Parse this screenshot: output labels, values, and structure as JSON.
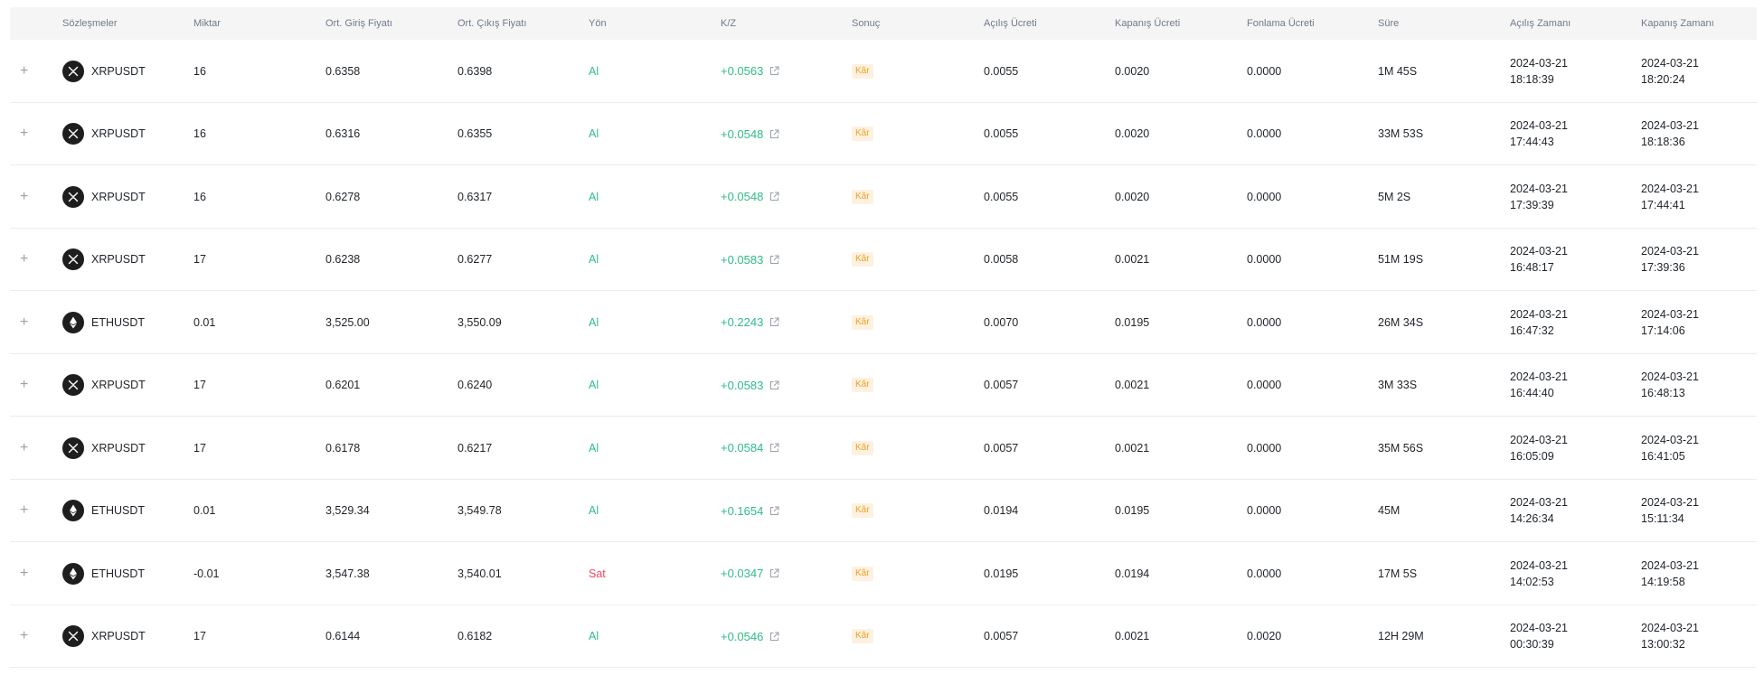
{
  "columns": {
    "contract": "Sözleşmeler",
    "qty": "Miktar",
    "entry": "Ort. Giriş Fiyatı",
    "exit": "Ort. Çıkış Fiyatı",
    "side": "Yön",
    "pnl": "K/Z",
    "result": "Sonuç",
    "open_fee": "Açılış Ücreti",
    "close_fee": "Kapanış Ücreti",
    "funding_fee": "Fonlama Ücreti",
    "duration": "Süre",
    "open_time": "Açılış Zamanı",
    "close_time": "Kapanış Zamanı"
  },
  "rows": [
    {
      "expand": "+",
      "icon": "xrp-icon",
      "symbol": "XRPUSDT",
      "qty": "16",
      "entry": "0.6358",
      "exit": "0.6398",
      "side": "Al",
      "side_type": "buy",
      "pnl": "+0.0563",
      "result": "Kâr",
      "open_fee": "0.0055",
      "close_fee": "0.0020",
      "funding_fee": "0.0000",
      "duration": "1M 45S",
      "open_date": "2024-03-21",
      "open_clock": "18:18:39",
      "close_date": "2024-03-21",
      "close_clock": "18:20:24"
    },
    {
      "expand": "+",
      "icon": "xrp-icon",
      "symbol": "XRPUSDT",
      "qty": "16",
      "entry": "0.6316",
      "exit": "0.6355",
      "side": "Al",
      "side_type": "buy",
      "pnl": "+0.0548",
      "result": "Kâr",
      "open_fee": "0.0055",
      "close_fee": "0.0020",
      "funding_fee": "0.0000",
      "duration": "33M 53S",
      "open_date": "2024-03-21",
      "open_clock": "17:44:43",
      "close_date": "2024-03-21",
      "close_clock": "18:18:36"
    },
    {
      "expand": "+",
      "icon": "xrp-icon",
      "symbol": "XRPUSDT",
      "qty": "16",
      "entry": "0.6278",
      "exit": "0.6317",
      "side": "Al",
      "side_type": "buy",
      "pnl": "+0.0548",
      "result": "Kâr",
      "open_fee": "0.0055",
      "close_fee": "0.0020",
      "funding_fee": "0.0000",
      "duration": "5M 2S",
      "open_date": "2024-03-21",
      "open_clock": "17:39:39",
      "close_date": "2024-03-21",
      "close_clock": "17:44:41"
    },
    {
      "expand": "+",
      "icon": "xrp-icon",
      "symbol": "XRPUSDT",
      "qty": "17",
      "entry": "0.6238",
      "exit": "0.6277",
      "side": "Al",
      "side_type": "buy",
      "pnl": "+0.0583",
      "result": "Kâr",
      "open_fee": "0.0058",
      "close_fee": "0.0021",
      "funding_fee": "0.0000",
      "duration": "51M 19S",
      "open_date": "2024-03-21",
      "open_clock": "16:48:17",
      "close_date": "2024-03-21",
      "close_clock": "17:39:36"
    },
    {
      "expand": "+",
      "icon": "eth-icon",
      "symbol": "ETHUSDT",
      "qty": "0.01",
      "entry": "3,525.00",
      "exit": "3,550.09",
      "side": "Al",
      "side_type": "buy",
      "pnl": "+0.2243",
      "result": "Kâr",
      "open_fee": "0.0070",
      "close_fee": "0.0195",
      "funding_fee": "0.0000",
      "duration": "26M 34S",
      "open_date": "2024-03-21",
      "open_clock": "16:47:32",
      "close_date": "2024-03-21",
      "close_clock": "17:14:06"
    },
    {
      "expand": "+",
      "icon": "xrp-icon",
      "symbol": "XRPUSDT",
      "qty": "17",
      "entry": "0.6201",
      "exit": "0.6240",
      "side": "Al",
      "side_type": "buy",
      "pnl": "+0.0583",
      "result": "Kâr",
      "open_fee": "0.0057",
      "close_fee": "0.0021",
      "funding_fee": "0.0000",
      "duration": "3M 33S",
      "open_date": "2024-03-21",
      "open_clock": "16:44:40",
      "close_date": "2024-03-21",
      "close_clock": "16:48:13"
    },
    {
      "expand": "+",
      "icon": "xrp-icon",
      "symbol": "XRPUSDT",
      "qty": "17",
      "entry": "0.6178",
      "exit": "0.6217",
      "side": "Al",
      "side_type": "buy",
      "pnl": "+0.0584",
      "result": "Kâr",
      "open_fee": "0.0057",
      "close_fee": "0.0021",
      "funding_fee": "0.0000",
      "duration": "35M 56S",
      "open_date": "2024-03-21",
      "open_clock": "16:05:09",
      "close_date": "2024-03-21",
      "close_clock": "16:41:05"
    },
    {
      "expand": "+",
      "icon": "eth-icon",
      "symbol": "ETHUSDT",
      "qty": "0.01",
      "entry": "3,529.34",
      "exit": "3,549.78",
      "side": "Al",
      "side_type": "buy",
      "pnl": "+0.1654",
      "result": "Kâr",
      "open_fee": "0.0194",
      "close_fee": "0.0195",
      "funding_fee": "0.0000",
      "duration": "45M",
      "open_date": "2024-03-21",
      "open_clock": "14:26:34",
      "close_date": "2024-03-21",
      "close_clock": "15:11:34"
    },
    {
      "expand": "+",
      "icon": "eth-icon",
      "symbol": "ETHUSDT",
      "qty": "-0.01",
      "entry": "3,547.38",
      "exit": "3,540.01",
      "side": "Sat",
      "side_type": "sell",
      "pnl": "+0.0347",
      "result": "Kâr",
      "open_fee": "0.0195",
      "close_fee": "0.0194",
      "funding_fee": "0.0000",
      "duration": "17M 5S",
      "open_date": "2024-03-21",
      "open_clock": "14:02:53",
      "close_date": "2024-03-21",
      "close_clock": "14:19:58"
    },
    {
      "expand": "+",
      "icon": "xrp-icon",
      "symbol": "XRPUSDT",
      "qty": "17",
      "entry": "0.6144",
      "exit": "0.6182",
      "side": "Al",
      "side_type": "buy",
      "pnl": "+0.0546",
      "result": "Kâr",
      "open_fee": "0.0057",
      "close_fee": "0.0021",
      "funding_fee": "0.0020",
      "duration": "12H 29M",
      "open_date": "2024-03-21",
      "open_clock": "00:30:39",
      "close_date": "2024-03-21",
      "close_clock": "13:00:32"
    }
  ],
  "colors": {
    "buy": "#2ebd85",
    "sell": "#f6465d",
    "badge_bg": "#fef1e1",
    "badge_text": "#f0a020",
    "header_bg": "#f5f5f5"
  }
}
